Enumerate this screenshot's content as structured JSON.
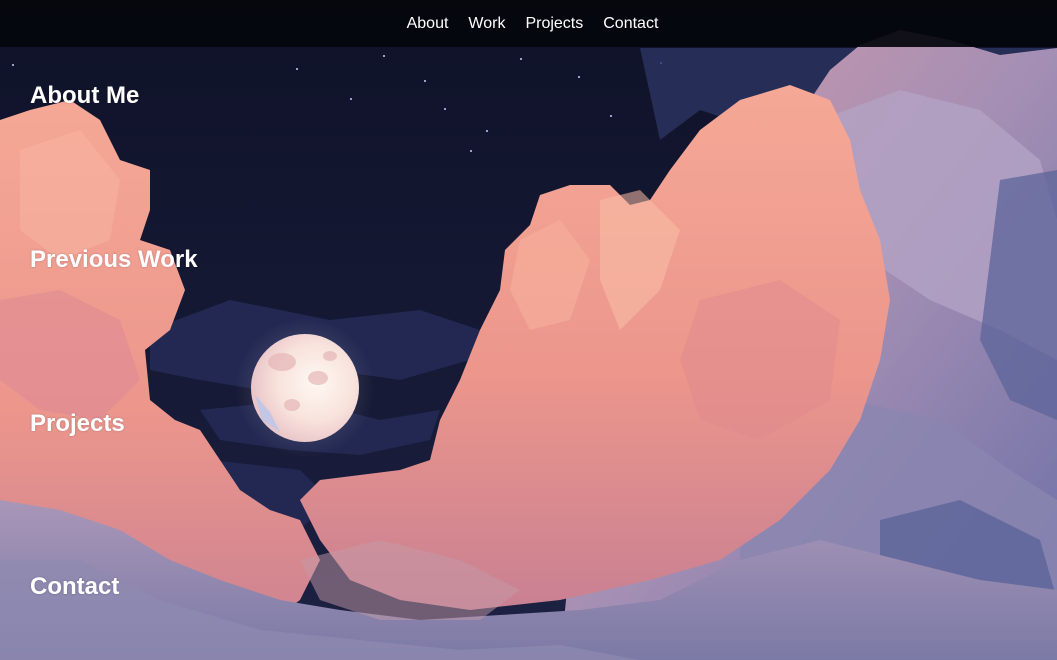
{
  "nav": {
    "links": [
      {
        "label": "About",
        "icon": null
      },
      {
        "label": "Work",
        "icon": null
      },
      {
        "label": "Projects",
        "icon": null
      },
      {
        "label": "Contact",
        "icon": null
      }
    ]
  },
  "sections": [
    {
      "heading": "About Me"
    },
    {
      "heading": "Previous Work"
    },
    {
      "heading": "Projects"
    },
    {
      "heading": "Contact"
    }
  ],
  "background": {
    "image": "pixel-art-night-sky-with-full-moon-and-pink-clouds",
    "colors": {
      "sky": "#141833",
      "cloud_pink": "#f0a090",
      "cloud_lilac": "#a392b8",
      "cloud_blue": "#5c6599",
      "moon": "#fbeee6",
      "navbar": "#05070c"
    }
  }
}
